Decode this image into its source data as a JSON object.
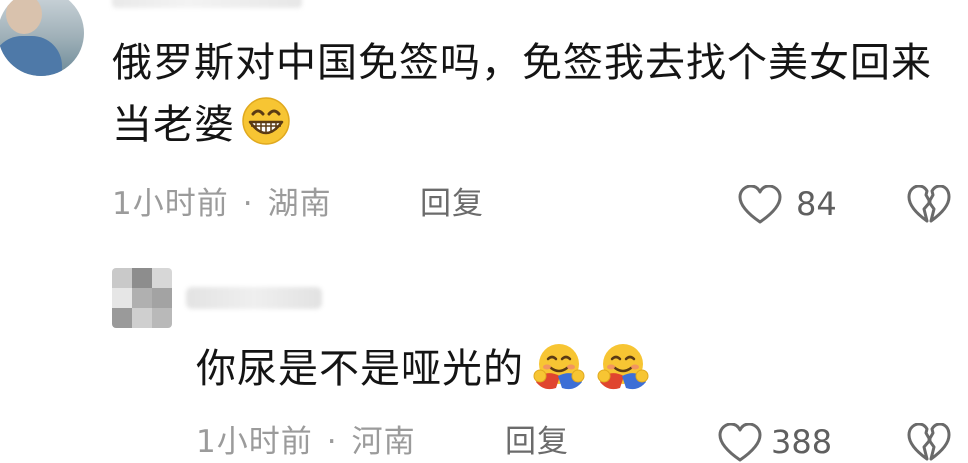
{
  "comments": [
    {
      "text": "俄罗斯对中国免签吗，免签我去找个美女回来当老婆",
      "emoji": "grinning-face",
      "time": "1小时前",
      "separator": "·",
      "location": "湖南",
      "reply_label": "回复",
      "likes": "84"
    },
    {
      "text": "你尿是不是哑光的",
      "emoji": "hugging-face",
      "emoji_count": 2,
      "time": "1小时前",
      "separator": "·",
      "location": "河南",
      "reply_label": "回复",
      "likes": "388"
    }
  ],
  "icons": {
    "like": "heart-outline-icon",
    "dislike": "broken-heart-icon"
  },
  "colors": {
    "text": "#141414",
    "meta": "#9b9b9b",
    "icon": "#6a6a6a",
    "emoji_face": "#f7c533"
  }
}
